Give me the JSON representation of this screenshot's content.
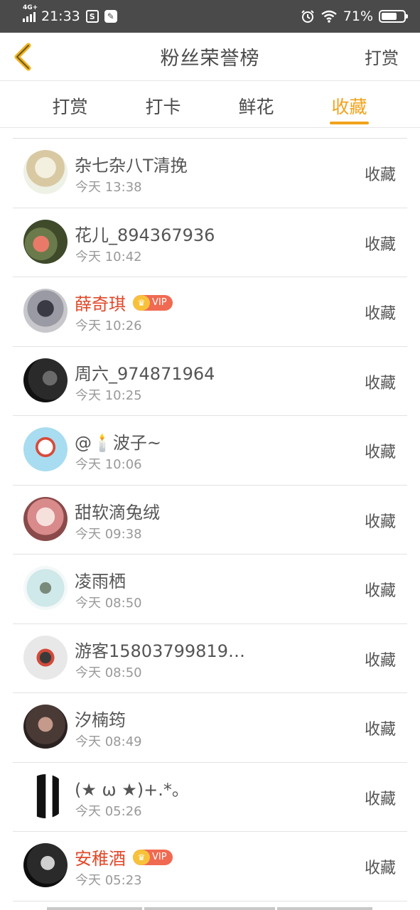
{
  "status": {
    "network": "4G+",
    "time": "21:33",
    "battery": "71%",
    "battery_level": 0.71
  },
  "header": {
    "title": "粉丝荣誉榜",
    "right_action": "打赏"
  },
  "tabs": [
    {
      "label": "打赏",
      "active": false
    },
    {
      "label": "打卡",
      "active": false
    },
    {
      "label": "鲜花",
      "active": false
    },
    {
      "label": "收藏",
      "active": true
    }
  ],
  "vip_label": "VIP",
  "fans": [
    {
      "name": "杂七杂八T清挽",
      "time": "今天 13:38",
      "action": "收藏",
      "vip": false
    },
    {
      "name": "花儿_894367936",
      "time": "今天 10:42",
      "action": "收藏",
      "vip": false
    },
    {
      "name": "薛奇琪",
      "time": "今天 10:26",
      "action": "收藏",
      "vip": true
    },
    {
      "name": "周六_974871964",
      "time": "今天 10:25",
      "action": "收藏",
      "vip": false
    },
    {
      "name": "@🕯️波子~",
      "time": "今天 10:06",
      "action": "收藏",
      "vip": false
    },
    {
      "name": "甜软滴兔绒",
      "time": "今天 09:38",
      "action": "收藏",
      "vip": false
    },
    {
      "name": "凌雨栖",
      "time": "今天 08:50",
      "action": "收藏",
      "vip": false
    },
    {
      "name": "游客15803799819…",
      "time": "今天 08:50",
      "action": "收藏",
      "vip": false
    },
    {
      "name": "汐楠筠",
      "time": "今天 08:49",
      "action": "收藏",
      "vip": false
    },
    {
      "name": "(★ ω ★)+.*。",
      "time": "今天 05:26",
      "action": "收藏",
      "vip": false
    },
    {
      "name": "安稚酒",
      "time": "今天 05:23",
      "action": "收藏",
      "vip": true
    }
  ],
  "colors": {
    "accent": "#f2a21b",
    "vip_name": "#e0492a",
    "status_bar": "#4a4a4a"
  }
}
